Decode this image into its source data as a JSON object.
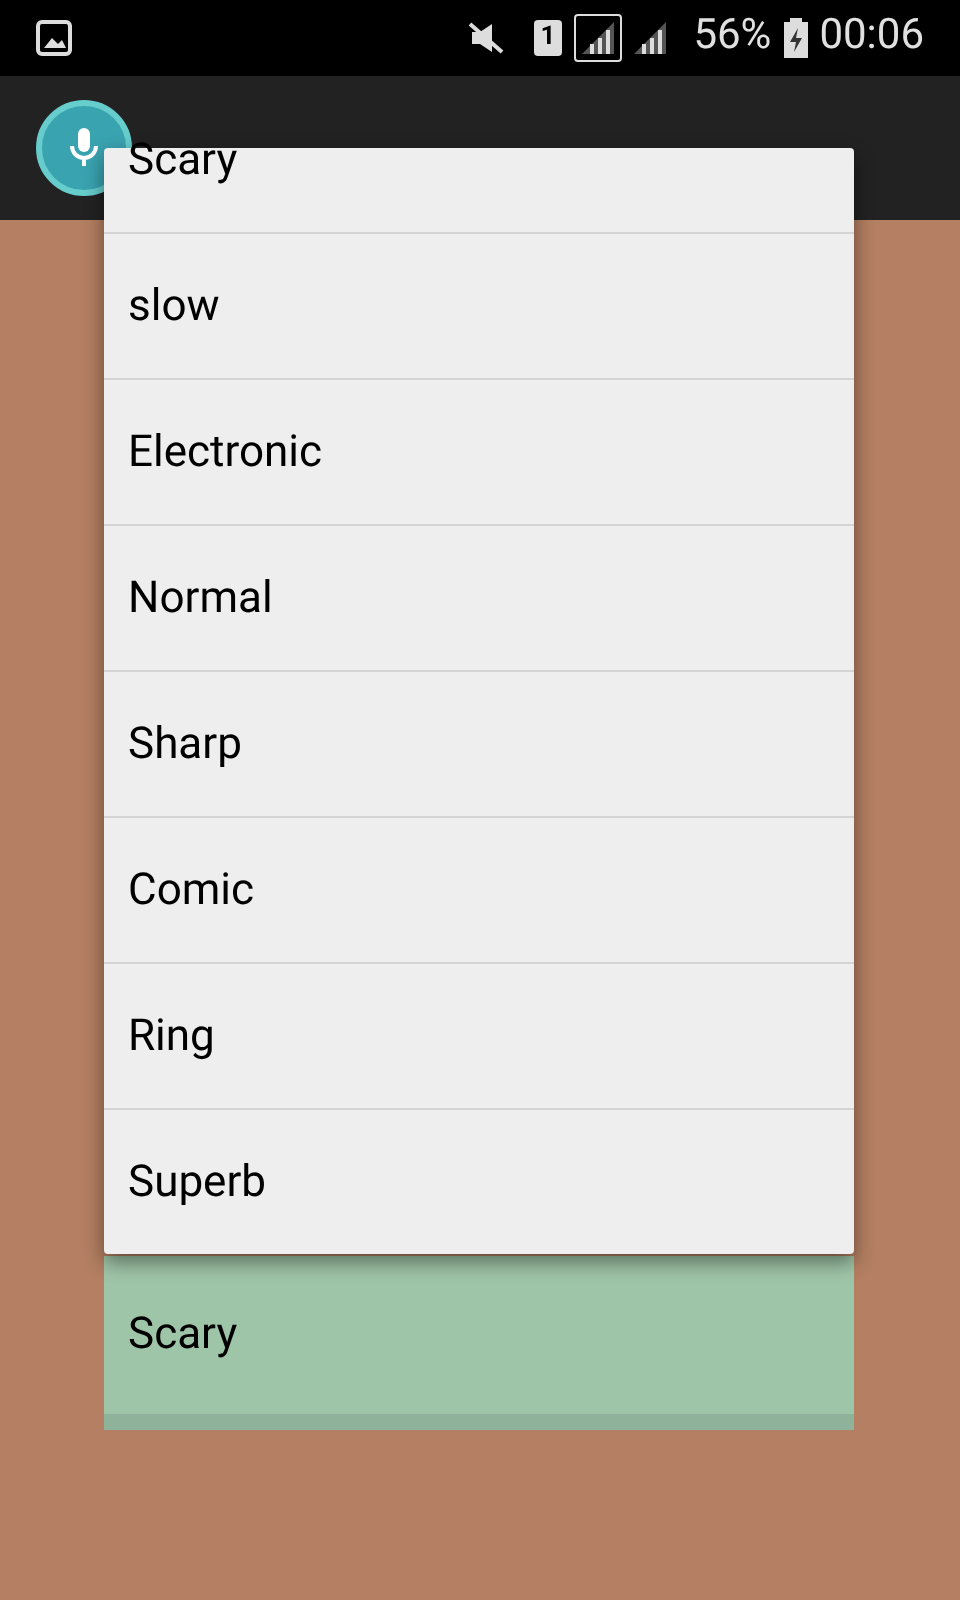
{
  "status_bar": {
    "sim": "1",
    "battery": "56%",
    "time": "00:06"
  },
  "dropdown": {
    "items": [
      {
        "label": "Scary",
        "selected": false
      },
      {
        "label": "slow",
        "selected": false
      },
      {
        "label": "Electronic",
        "selected": false
      },
      {
        "label": "Normal",
        "selected": false
      },
      {
        "label": "Sharp",
        "selected": false
      },
      {
        "label": "Comic",
        "selected": false
      },
      {
        "label": "Ring",
        "selected": false
      },
      {
        "label": "Superb",
        "selected": false
      }
    ]
  },
  "spinner": {
    "value": "Scary"
  }
}
